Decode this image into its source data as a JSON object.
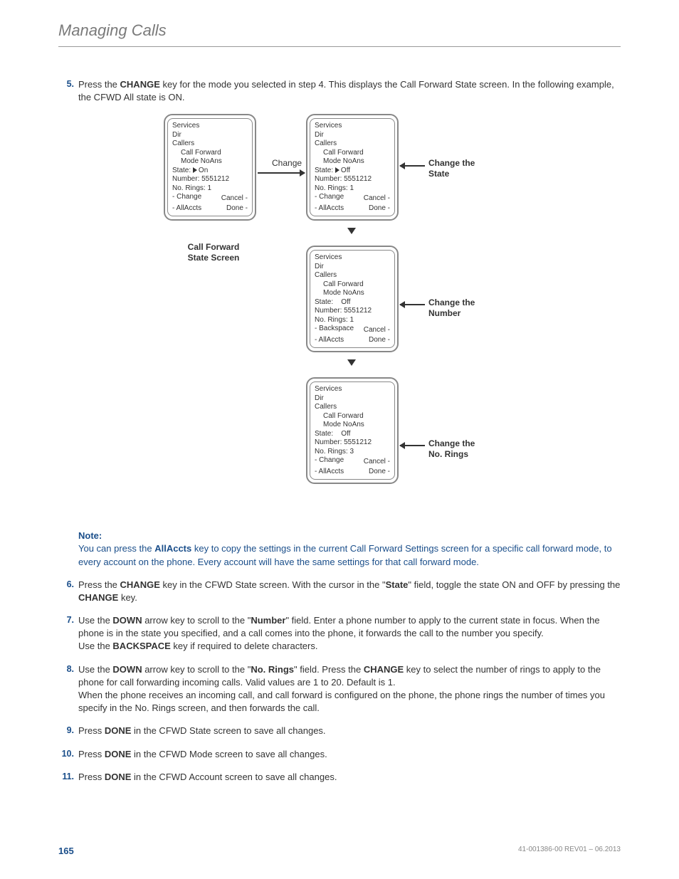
{
  "header": {
    "title": "Managing Calls"
  },
  "steps": {
    "s5": {
      "num": "5.",
      "text_before": "Press the ",
      "bold1": "CHANGE",
      "text_mid": " key for the mode you selected in step 4. This displays the Call Forward State screen. In the following example, the CFWD All state is ON."
    },
    "s6": {
      "num": "6.",
      "p1a": "Press the ",
      "b1": "CHANGE",
      "p1b": " key in the CFWD State screen. With the cursor in the \"",
      "b2": "State",
      "p1c": "\" field, toggle the state ON and OFF by pressing the ",
      "b3": "CHANGE",
      "p1d": " key."
    },
    "s7": {
      "num": "7.",
      "p1a": "Use the ",
      "b1": "DOWN",
      "p1b": " arrow key to scroll to the \"",
      "b2": "Number",
      "p1c": "\" field. Enter a phone number to apply to the current state in focus. When the phone is in the state you specified, and a call comes into the phone, it forwards the call to the number you specify.",
      "p2a": "Use the ",
      "b3": "BACKSPACE",
      "p2b": " key if required to delete characters."
    },
    "s8": {
      "num": "8.",
      "p1a": "Use the ",
      "b1": "DOWN",
      "p1b": " arrow key to scroll to the \"",
      "b2": "No. Rings",
      "p1c": "\" field. Press the ",
      "b3": "CHANGE",
      "p1d": " key to select the number of rings to apply to the phone for call forwarding incoming calls. Valid values are 1 to 20. Default is 1.",
      "p2": "When the phone receives an incoming call, and call forward is configured on the phone, the phone rings the number of times you specify in the No. Rings screen, and then forwards the call."
    },
    "s9": {
      "num": "9.",
      "a": "Press ",
      "b": "DONE",
      "c": " in the CFWD State screen to save all changes."
    },
    "s10": {
      "num": "10.",
      "a": "Press ",
      "b": "DONE",
      "c": " in the CFWD Mode screen to save all changes."
    },
    "s11": {
      "num": "11.",
      "a": "Press ",
      "b": "DONE",
      "c": " in the CFWD Account screen to save all changes."
    }
  },
  "note": {
    "label": "Note:",
    "a": "You can press the ",
    "b": "AllAccts",
    "c": " key to copy the settings in the current Call Forward Settings screen for a specific call forward mode, to every account on the phone. Every account will have the same settings for that call forward mode."
  },
  "diagram": {
    "change_label": "Change",
    "label_left": "Call Forward\nState Screen",
    "label_state": "Change the\nState",
    "label_number": "Change the\nNumber",
    "label_rings": "Change the\nNo. Rings",
    "screens": {
      "a": {
        "l1": "Services",
        "l2": "Dir",
        "l3": "Callers",
        "l4": "Call Forward",
        "l5": "Mode NoAns",
        "state": "State:",
        "state_val": "On",
        "number": "Number: 5551212",
        "rings": "No. Rings: 1",
        "opt1": "- Change",
        "cancel": "Cancel -",
        "bl": "- AllAccts",
        "br": "Done -"
      },
      "b": {
        "l1": "Services",
        "l2": "Dir",
        "l3": "Callers",
        "l4": "Call Forward",
        "l5": "Mode NoAns",
        "state": "State:",
        "state_val": "Off",
        "number": "Number: 5551212",
        "rings": "No. Rings: 1",
        "opt1": "- Change",
        "cancel": "Cancel -",
        "bl": "- AllAccts",
        "br": "Done -"
      },
      "c": {
        "l1": "Services",
        "l2": "Dir",
        "l3": "Callers",
        "l4": "Call Forward",
        "l5": "Mode NoAns",
        "state": "State:",
        "state_val": "Off",
        "number": "Number: 5551212",
        "rings": "No. Rings: 1",
        "opt1": "- Backspace",
        "cancel": "Cancel -",
        "bl": "- AllAccts",
        "br": "Done -"
      },
      "d": {
        "l1": "Services",
        "l2": "Dir",
        "l3": "Callers",
        "l4": "Call Forward",
        "l5": "Mode NoAns",
        "state": "State:",
        "state_val": "Off",
        "number": "Number: 5551212",
        "rings": "No. Rings: 3",
        "opt1": "- Change",
        "cancel": "Cancel -",
        "bl": "- AllAccts",
        "br": "Done -"
      }
    }
  },
  "footer": {
    "page": "165",
    "docid": "41-001386-00 REV01 – 06.2013"
  }
}
